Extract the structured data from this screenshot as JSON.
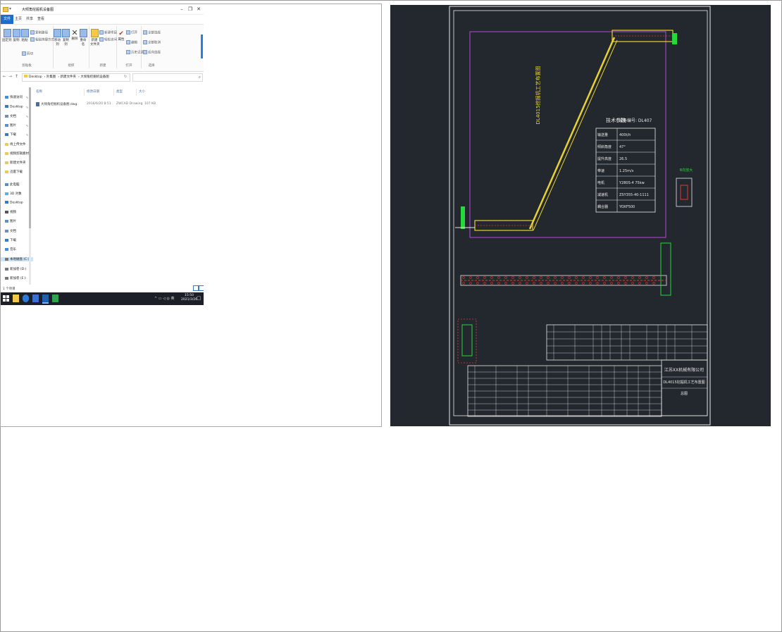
{
  "explorer": {
    "window_title": "大倾角挖掘机设备图",
    "ribbon_tabs": [
      "文件",
      "主页",
      "共享",
      "查看"
    ],
    "ribbon": {
      "pin_quick_access": "固定到\"快速访问\"",
      "copy": "复制",
      "paste": "粘贴",
      "copy_path": "复制路径",
      "paste_shortcut": "粘贴快捷方式",
      "cut": "剪切",
      "clipboard_group": "剪贴板",
      "move_to": "移动到",
      "copy_to": "复制到",
      "delete": "删除",
      "rename": "重命名",
      "organize_group": "组织",
      "new_folder": "新建\n文件夹",
      "new_item": "新建项目",
      "easy_access": "轻松访问",
      "new_group": "新建",
      "properties": "属性",
      "open": "打开",
      "edit": "编辑",
      "history": "历史记录",
      "open_group": "打开",
      "select_all": "全部选择",
      "select_none": "全部取消",
      "invert_selection": "反向选择",
      "select_group": "选择"
    },
    "address_path": [
      "Desktop",
      "外集图",
      "新建文件夹",
      "大倾角挖掘机设备图"
    ],
    "nav": {
      "quick_access": "快速访问",
      "desktop": "Desktop",
      "documents": "文档",
      "pictures": "图片",
      "downloads": "下载",
      "folder1": "待上传文件",
      "folder2": "视频剪辑素材",
      "folder3": "新建文件夹",
      "folder4": "迅雷下载",
      "this_pc": "此电脑",
      "objects3d": "3D 对象",
      "desktop2": "Desktop",
      "videos": "视频",
      "pictures2": "图片",
      "documents2": "文档",
      "downloads2": "下载",
      "music": "音乐",
      "drive_c": "本地磁盘 (C:)",
      "drive_d": "新加卷 (D:)",
      "drive_e": "新加卷 (E:)"
    },
    "columns": {
      "name": "名称",
      "modified": "修改日期",
      "type": "类型",
      "size": "大小"
    },
    "file": {
      "name": "大倾角挖掘机设备图.dwg",
      "modified": "2016/6/20 8:51",
      "type": "ZWCAD Drawing",
      "size": "107 KB"
    },
    "status_count": "1 个项目",
    "taskbar": {
      "time": "15:50",
      "date": "2021/3/26"
    }
  },
  "cad": {
    "colors": {
      "background": "#23272e",
      "frame": "#e8e8e8",
      "magenta": "#b04bd6",
      "yellow": "#e6d233",
      "green": "#25d93a",
      "red": "#e0392f"
    },
    "title": "DL4015挖掘机工艺布置图",
    "spec_header": "技术参数",
    "spec_code": "设备编号: DL407",
    "spec_rows": [
      {
        "k": "输送量",
        "v": "400t/h"
      },
      {
        "k": "倾斜角度",
        "v": "47°"
      },
      {
        "k": "提升高度",
        "v": "26.5"
      },
      {
        "k": "带速",
        "v": "1.25m/s"
      },
      {
        "k": "电机",
        "v": "Y280S-4 75kw"
      },
      {
        "k": "减速机",
        "v": "ZSY355-40-1111"
      },
      {
        "k": "耦合器",
        "v": "YOXF500"
      }
    ],
    "title_block_company": "江苏XX机械有限公司",
    "title_block_drawing": "DL4015挖掘机工艺布置图",
    "title_block_sheet": "总图",
    "detail_label": "B向放大"
  }
}
